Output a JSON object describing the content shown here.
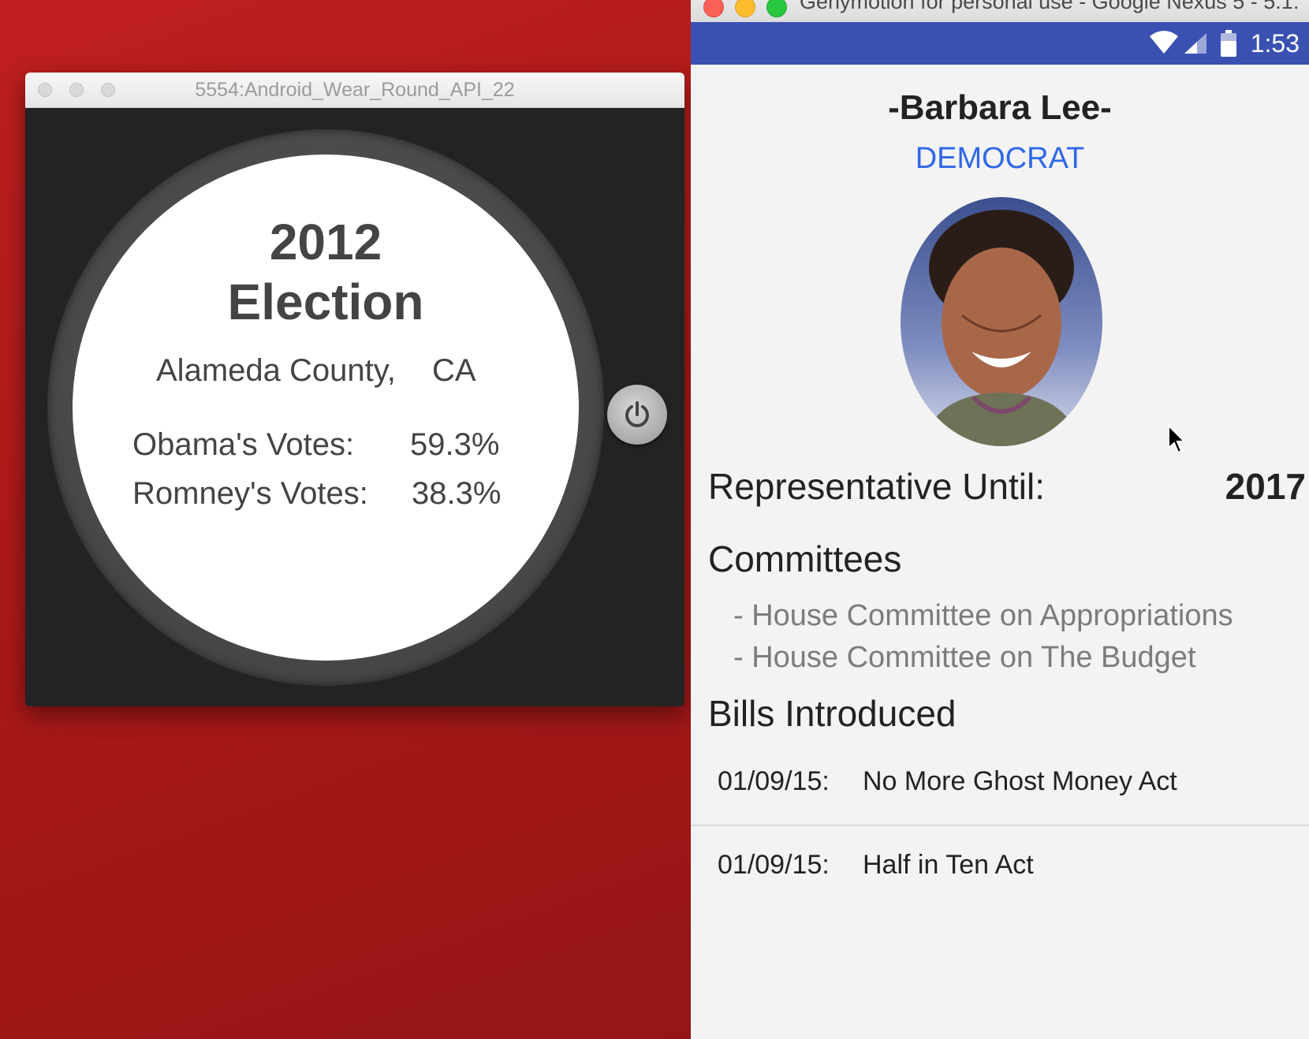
{
  "emulator": {
    "title": "5554:Android_Wear_Round_API_22",
    "watch": {
      "year": "2012",
      "election": "Election",
      "county": "Alameda County,",
      "state": "CA",
      "votes": [
        {
          "label": "Obama's Votes:",
          "value": "59.3%"
        },
        {
          "label": "Romney's Votes:",
          "value": "38.3%"
        }
      ]
    },
    "power_icon": "power-icon"
  },
  "genymotion": {
    "title": "Genymotion for personal use - Google Nexus 5 - 5.1.",
    "status_bar": {
      "time": "1:53",
      "icons": [
        "wifi-icon",
        "signal-icon",
        "battery-icon"
      ],
      "color": "#3a51b2"
    }
  },
  "representative": {
    "name": "-Barbara Lee-",
    "party": "DEMOCRAT",
    "party_color": "#2f67e8",
    "until_label": "Representative Until:",
    "until_value": "2017",
    "committees_title": "Committees",
    "committees": [
      "- House Committee on Appropriations",
      "- House Committee on The Budget"
    ],
    "bills_title": "Bills Introduced",
    "bills": [
      {
        "date": "01/09/15:",
        "title": "No More Ghost Money Act"
      },
      {
        "date": "01/09/15:",
        "title": "Half in Ten Act"
      }
    ]
  }
}
